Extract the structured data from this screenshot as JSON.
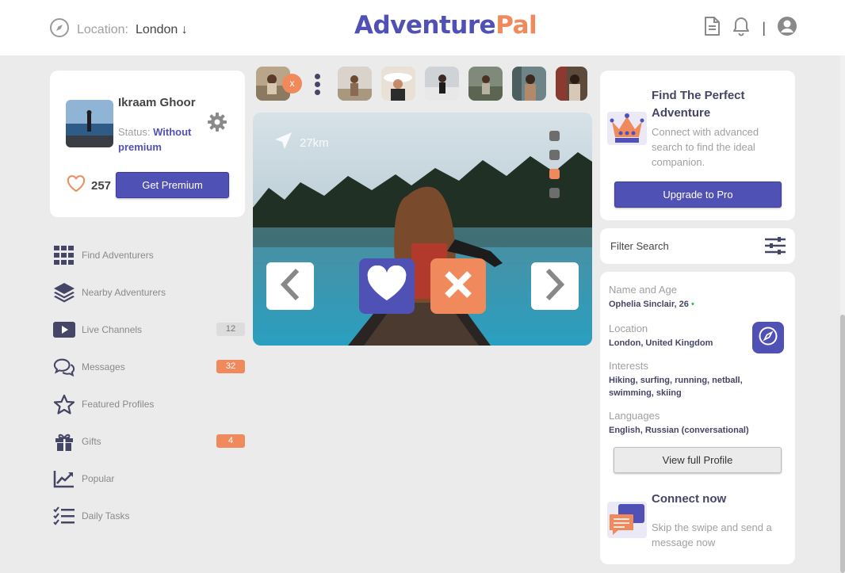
{
  "header": {
    "location_label": "Location:",
    "location_value": "London ↓",
    "logo_part1": "Adventure",
    "logo_part2": "Pal",
    "separator": "|"
  },
  "icons": {
    "location": "compass-icon",
    "document": "document-icon",
    "notifications": "bell-icon",
    "account": "user-circle-icon"
  },
  "profile": {
    "name": "Ikraam Ghoor",
    "status_label": "Status:",
    "status_value": "Without premium",
    "likes": "257",
    "premium_button": "Get Premium"
  },
  "nav": [
    {
      "label": "Find Adventurers",
      "icon": "grid-icon"
    },
    {
      "label": "Nearby Adventurers",
      "icon": "layers-icon"
    },
    {
      "label": "Live Channels",
      "icon": "play-icon",
      "badge": "12"
    },
    {
      "label": "Messages",
      "icon": "chat-icon",
      "badge": "32"
    },
    {
      "label": "Featured Profiles",
      "icon": "star-icon"
    },
    {
      "label": "Gifts",
      "icon": "gift-icon",
      "badge": "4"
    },
    {
      "label": "Popular",
      "icon": "trend-icon"
    },
    {
      "label": "Daily Tasks",
      "icon": "checklist-icon"
    }
  ],
  "thumbs": {
    "close_label": "x",
    "count": 8
  },
  "card": {
    "distance": "27km",
    "page_index": 3,
    "page_count": 4
  },
  "promo": {
    "title": "Find The Perfect Adventure",
    "description": "Connect with advanced search to find the ideal companion.",
    "button": "Upgrade to Pro"
  },
  "filter": {
    "label": "Filter Search"
  },
  "details": {
    "name_label": "Name and Age",
    "name_value": "Ophelia Sinclair, 26",
    "online_dot": "•",
    "location_label": "Location",
    "location_value": "London, United Kingdom",
    "interests_label": "Interests",
    "interests_value": "Hiking, surfing, running, netball, swimming, skiing",
    "languages_label": "Languages",
    "languages_value": "English, Russian (conversational)",
    "view_button": "View full Profile",
    "connect_title": "Connect now",
    "connect_desc": "Skip the swipe and send a message now"
  },
  "colors": {
    "primary": "#5051b5",
    "accent": "#f08a5d",
    "background": "#ebebeb",
    "online": "#3cba54"
  }
}
